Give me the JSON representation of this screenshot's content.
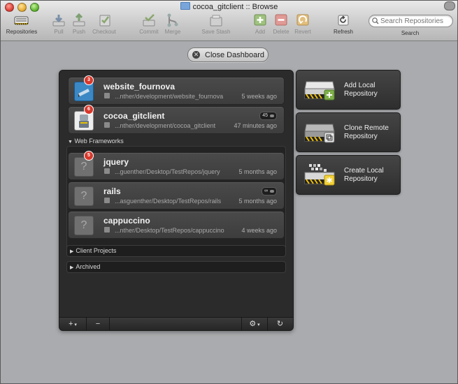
{
  "window": {
    "title": "cocoa_gitclient :: Browse"
  },
  "toolbar": {
    "items": [
      {
        "label": "Repositories"
      },
      {
        "label": "Pull"
      },
      {
        "label": "Push"
      },
      {
        "label": "Checkout"
      },
      {
        "label": "Commit"
      },
      {
        "label": "Merge"
      },
      {
        "label": "Save Stash"
      },
      {
        "label": "Add"
      },
      {
        "label": "Delete"
      },
      {
        "label": "Revert"
      },
      {
        "label": "Refresh"
      }
    ],
    "search": {
      "placeholder": "Search Repositories",
      "label": "Search"
    }
  },
  "dashboard": {
    "close_label": "Close Dashboard",
    "repos": [
      {
        "name": "website_fournova",
        "path": "...nther/development/website_fournova",
        "time": "5 weeks ago",
        "badge": "3"
      },
      {
        "name": "cocoa_gitclient",
        "path": "...nther/development/cocoa_gitclient",
        "time": "47 minutes ago",
        "badge": "6",
        "count": "45"
      }
    ],
    "groups": [
      {
        "name": "Web Frameworks",
        "repos": [
          {
            "name": "jquery",
            "path": "...guenther/Desktop/TestRepos/jquery",
            "time": "5 months ago",
            "badge": "5"
          },
          {
            "name": "rails",
            "path": "...asguenther/Desktop/TestRepos/rails",
            "time": "5 months ago",
            "count": "∞"
          },
          {
            "name": "cappuccino",
            "path": "...nther/Desktop/TestRepos/cappuccino",
            "time": "4 weeks ago"
          }
        ]
      },
      {
        "name": "Client Projects"
      },
      {
        "name": "Archived"
      }
    ],
    "footer": {
      "add": "+",
      "remove": "−",
      "gear": "⚙",
      "refresh": "↻"
    }
  },
  "actions": [
    {
      "label_line1": "Add Local",
      "label_line2": "Repository"
    },
    {
      "label_line1": "Clone Remote",
      "label_line2": "Repository"
    },
    {
      "label_line1": "Create Local",
      "label_line2": "Repository"
    }
  ],
  "colors": {
    "panel": "#2b2b2b",
    "badge": "#d8382b",
    "background": "#a9abae"
  }
}
